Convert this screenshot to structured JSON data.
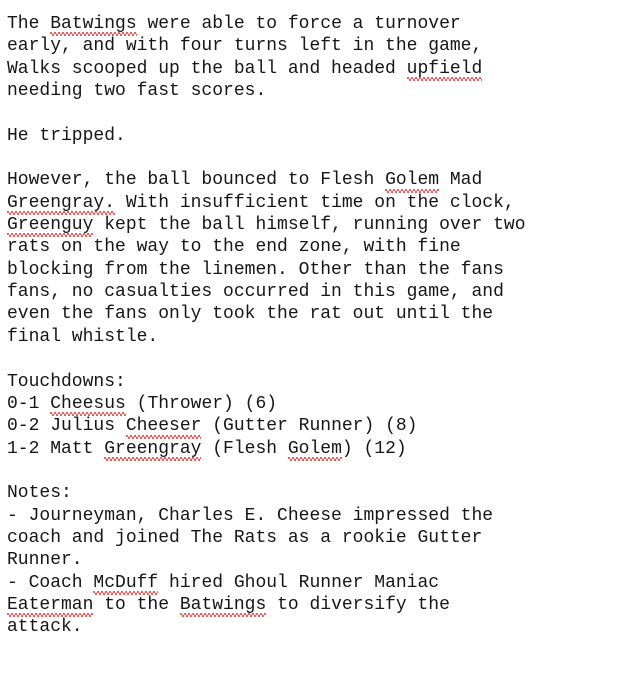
{
  "document": {
    "text_color": "#161616",
    "background_color": "#ffffff",
    "spellcheck_underline_color": "#e52b2b",
    "paragraphs": [
      {
        "name": "paragraph-turnover",
        "lines": [
          "The Batwings were able to force a turnover",
          "early, and with four turns left in the game,",
          "Walks scooped up the ball and headed upfield",
          "needing two fast scores."
        ]
      },
      {
        "name": "paragraph-he-tripped",
        "lines": [
          "He tripped."
        ]
      },
      {
        "name": "paragraph-however",
        "lines": [
          "However, the ball bounced to Flesh Golem Mad",
          "Greengray. With insufficient time on the clock,",
          "Greenguy kept the ball himself, running over two",
          "rats on the way to the end zone, with fine",
          "blocking from the linemen. Other than the fans",
          "fans, no casualties occurred in this game, and",
          "even the fans only took the rat out until the",
          "final whistle."
        ]
      },
      {
        "name": "paragraph-touchdowns",
        "lines": [
          "Touchdowns:",
          "0-1 Cheesus (Thrower) (6)",
          "0-2 Julius Cheeser (Gutter Runner) (8)",
          "1-2 Matt Greengray (Flesh Golem) (12)"
        ]
      },
      {
        "name": "paragraph-notes",
        "lines": [
          "Notes:",
          "- Journeyman, Charles E. Cheese impressed the",
          "coach and joined The Rats as a rookie Gutter",
          "Runner.",
          "- Coach McDuff hired Ghoul Runner Maniac",
          "Eaterman to the Batwings to diversify the",
          "attack."
        ]
      }
    ]
  },
  "lines": {
    "l1": {
      "a": "The ",
      "sp1": "Batwings",
      "b": " were able to force a turnover"
    },
    "l2": {
      "a": "early, and with four turns left in the game,"
    },
    "l3": {
      "a": "Walks scooped up the ball and headed ",
      "sp1": "upfield",
      "b": ""
    },
    "l4": {
      "a": "needing two fast scores."
    },
    "l5": {
      "a": "He tripped."
    },
    "l6": {
      "a": "However, the ball bounced to Flesh ",
      "sp1": "Golem",
      "b": " Mad"
    },
    "l7": {
      "sp1": "Greengray.",
      "b": " With insufficient time on the clock,"
    },
    "l8": {
      "sp1": "Greenguy",
      "b": " kept the ball himself, running over two"
    },
    "l9": {
      "a": "rats on the way to the end zone, with fine"
    },
    "l10": {
      "a": "blocking from the linemen. Other than the fans"
    },
    "l11": {
      "a": "fans, no casualties occurred in this game, and"
    },
    "l12": {
      "a": "even the fans only took the rat out until the"
    },
    "l13": {
      "a": "final whistle."
    },
    "l14": {
      "a": "Touchdowns:"
    },
    "l15": {
      "a": "0-1 ",
      "sp1": "Cheesus",
      "b": " (Thrower) (6)"
    },
    "l16": {
      "a": "0-2 Julius ",
      "sp1": "Cheeser",
      "b": " (Gutter Runner) (8)"
    },
    "l17": {
      "a": "1-2 Matt ",
      "sp1": "Greengray",
      "b": " (Flesh ",
      "sp2": "Golem",
      "c": ") (12)"
    },
    "l18": {
      "a": "Notes:"
    },
    "l19": {
      "a": "- Journeyman, Charles E. Cheese impressed the"
    },
    "l20": {
      "a": "coach and joined The Rats as a rookie Gutter"
    },
    "l21": {
      "a": "Runner."
    },
    "l22": {
      "a": "- Coach ",
      "sp1": "McDuff",
      "b": " hired Ghoul Runner Maniac"
    },
    "l23": {
      "sp1": "Eaterman",
      "b": " to the ",
      "sp2": "Batwings",
      "c": " to diversify the"
    },
    "l24": {
      "a": "attack."
    }
  },
  "misspelled_words": [
    "Batwings",
    "upfield",
    "Golem",
    "Greengray.",
    "Greenguy",
    "Cheesus",
    "Cheeser",
    "Greengray",
    "Golem",
    "McDuff",
    "Eaterman",
    "Batwings"
  ]
}
